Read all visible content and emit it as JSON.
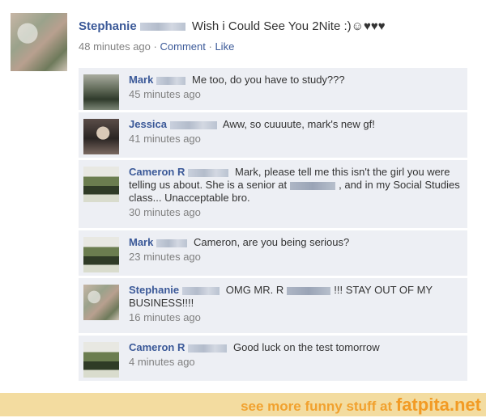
{
  "post": {
    "author": "Stephanie",
    "text": "Wish i Could See You 2Nite :)☺♥♥♥",
    "time": "48 minutes ago",
    "sep1": "·",
    "comment_label": "Comment",
    "sep2": "·",
    "like_label": "Like"
  },
  "comments": [
    {
      "author": "Mark",
      "text": "Me too, do you have to study???",
      "time": "45 minutes ago"
    },
    {
      "author": "Jessica",
      "text": "Aww, so cuuuute, mark's new gf!",
      "time": "41 minutes ago"
    },
    {
      "author": "Cameron R",
      "text_a": "Mark, please tell me this isn't the girl you were telling us about. She is a senior at",
      "text_b": ", and in my Social Studies class... Unacceptable bro.",
      "time": "30 minutes ago"
    },
    {
      "author": "Mark",
      "text": "Cameron, are you being serious?",
      "time": "23 minutes ago"
    },
    {
      "author": "Stephanie",
      "text_a": "OMG MR. R",
      "text_b": "!!! STAY OUT OF MY BUSINESS!!!!",
      "time": "16 minutes ago"
    },
    {
      "author": "Cameron R",
      "text": "Good luck on the test tomorrow",
      "time": "4 minutes ago"
    }
  ],
  "footer": {
    "text": "see more funny stuff at",
    "site": "fatpita.net"
  },
  "colors": {
    "name": "#3b5998",
    "comment_bg": "#edeff4",
    "footer_bg": "#f3dca0",
    "footer_text": "#f1a12e"
  }
}
